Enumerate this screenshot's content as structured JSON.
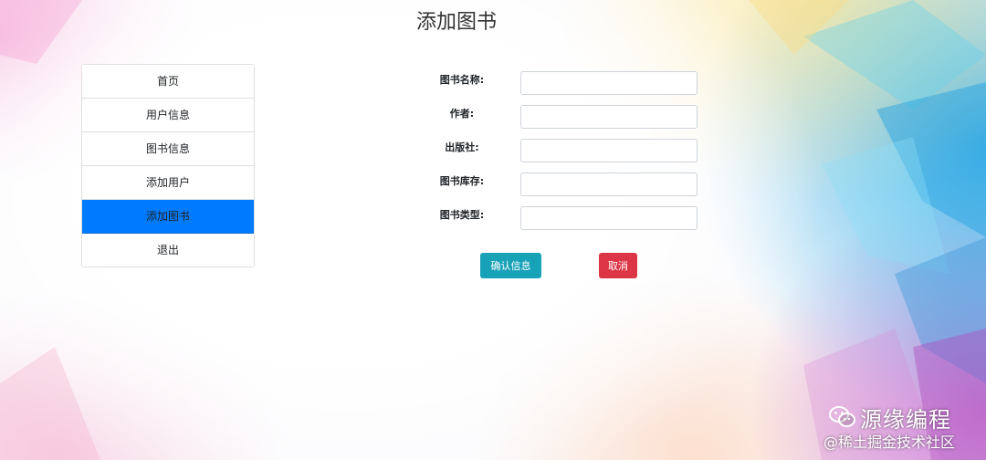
{
  "page": {
    "title": "添加图书"
  },
  "sidebar": {
    "items": [
      {
        "label": "首页",
        "active": false
      },
      {
        "label": "用户信息",
        "active": false
      },
      {
        "label": "图书信息",
        "active": false
      },
      {
        "label": "添加用户",
        "active": false
      },
      {
        "label": "添加图书",
        "active": true
      },
      {
        "label": "退出",
        "active": false
      }
    ],
    "active_color": "#007bff"
  },
  "form": {
    "fields": [
      {
        "label": "图书名称:",
        "value": ""
      },
      {
        "label": "作者:",
        "value": ""
      },
      {
        "label": "出版社:",
        "value": ""
      },
      {
        "label": "图书库存:",
        "value": ""
      },
      {
        "label": "图书类型:",
        "value": ""
      }
    ],
    "confirm_label": "确认信息",
    "confirm_color": "#17a2b8",
    "cancel_label": "取消",
    "cancel_color": "#dc3545"
  },
  "watermark": {
    "icon": "wechat-icon",
    "brand": "源缘编程",
    "site": "@稀土掘金技术社区"
  }
}
